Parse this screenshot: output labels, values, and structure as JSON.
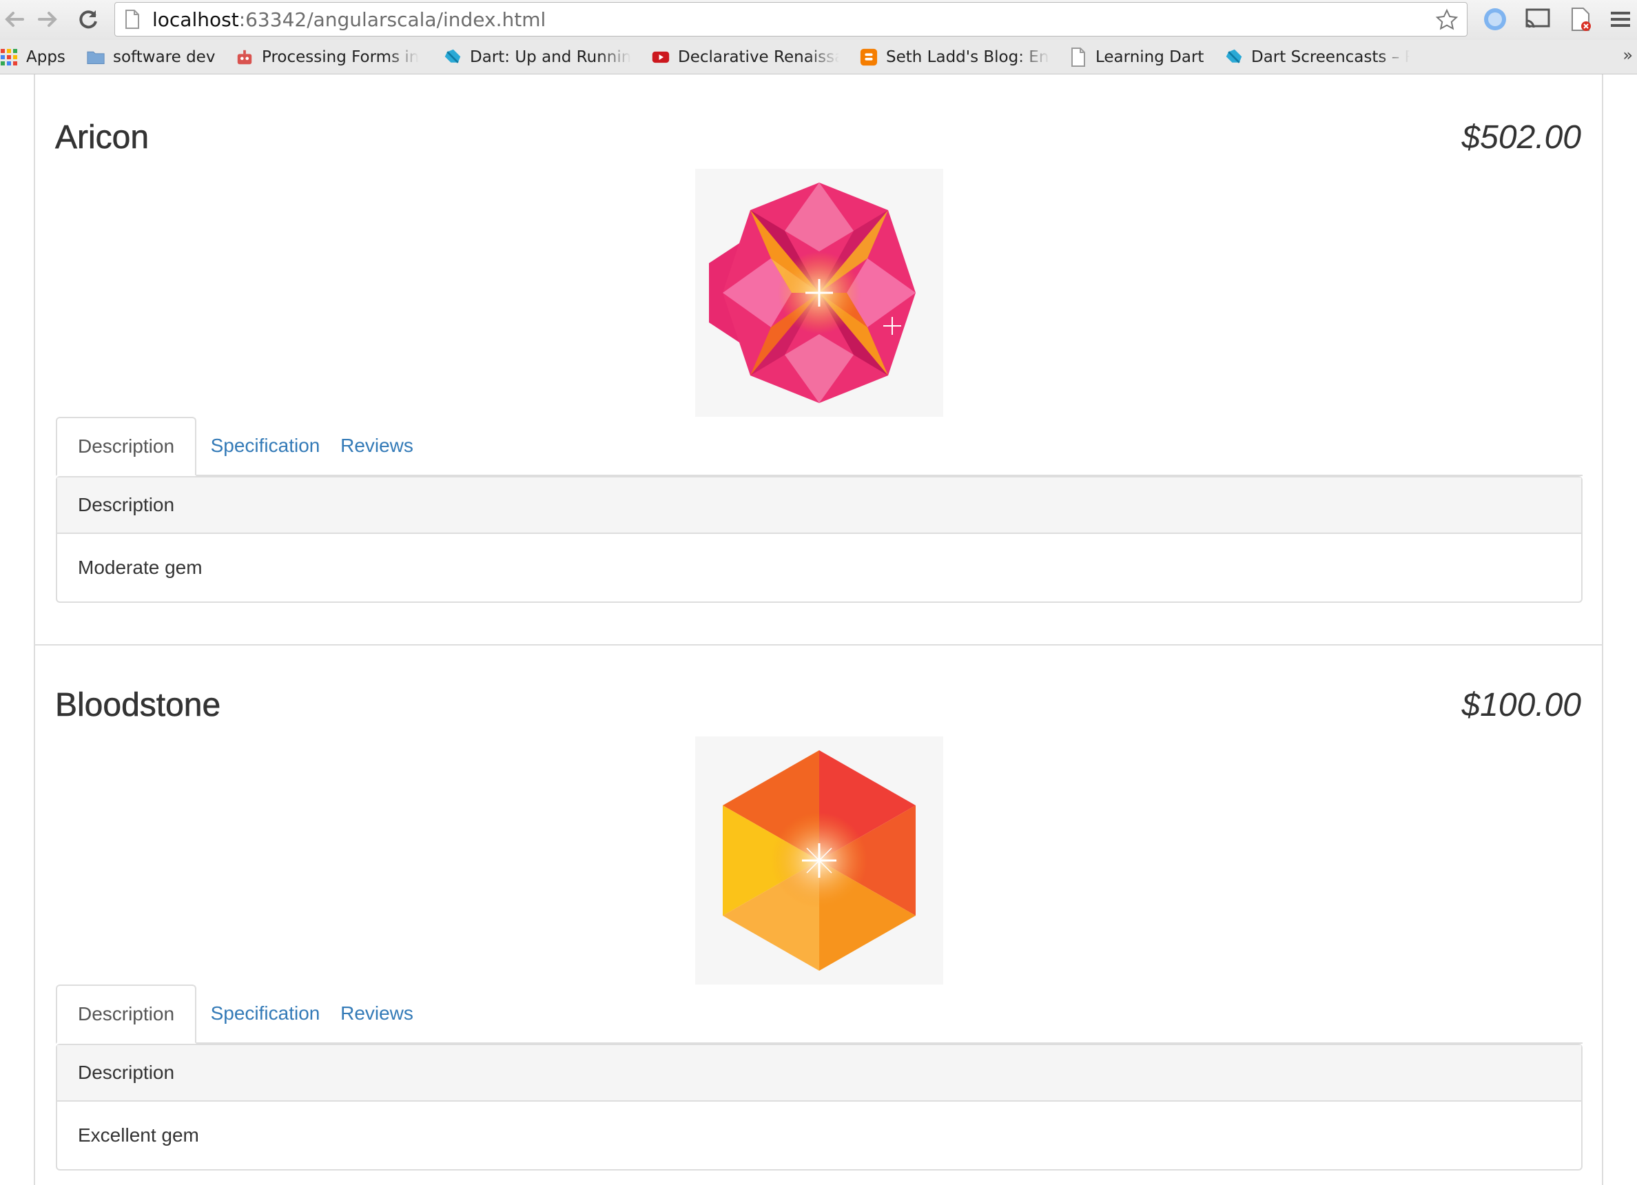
{
  "browser": {
    "url_host": "localhost",
    "url_rest": ":63342/angularscala/index.html",
    "bookmarks": [
      {
        "label": "Apps",
        "icon": "apps-grid-icon"
      },
      {
        "label": "software dev",
        "icon": "folder-icon"
      },
      {
        "label": "Processing Forms in",
        "icon": "robot-icon"
      },
      {
        "label": "Dart: Up and Runnin",
        "icon": "dart-icon"
      },
      {
        "label": "Declarative Renaissa",
        "icon": "youtube-icon"
      },
      {
        "label": "Seth Ladd's Blog: Ena",
        "icon": "blogger-icon"
      },
      {
        "label": "Learning Dart",
        "icon": "page-icon"
      },
      {
        "label": "Dart Screencasts – R",
        "icon": "dart-icon"
      }
    ],
    "more_label": "»"
  },
  "products": [
    {
      "name": "Aricon",
      "price": "$502.00",
      "tabs": [
        "Description",
        "Specification",
        "Reviews"
      ],
      "active_tab": "Description",
      "panel_heading": "Description",
      "panel_body": "Moderate gem"
    },
    {
      "name": "Bloodstone",
      "price": "$100.00",
      "tabs": [
        "Description",
        "Specification",
        "Reviews"
      ],
      "active_tab": "Description",
      "panel_heading": "Description",
      "panel_body": "Excellent gem"
    }
  ],
  "colors": {
    "link": "#337ab7",
    "border": "#dddddd",
    "panel_heading_bg": "#f5f5f5"
  }
}
